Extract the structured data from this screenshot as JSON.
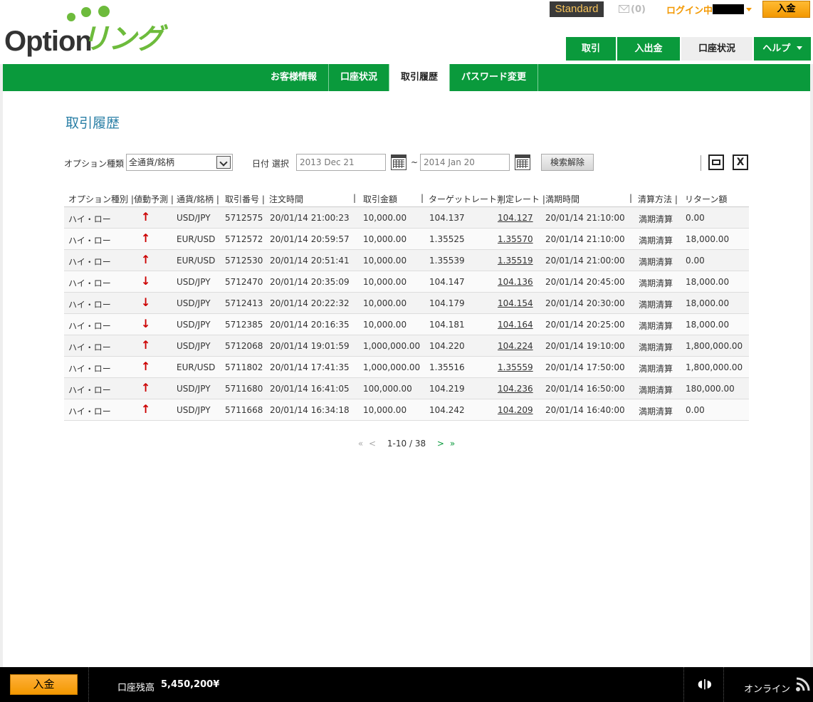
{
  "header": {
    "logo_text": "Option",
    "logo_kana": "リング",
    "account_type": "Standard",
    "mail_count": "(0)",
    "login_status": "ログイン中",
    "deposit_label": "入金",
    "main_tabs": [
      "取引",
      "入出金",
      "口座状況",
      "ヘルプ"
    ],
    "active_main_tab": "口座状況"
  },
  "subnav": {
    "items": [
      "お客様情報",
      "口座状況",
      "取引履歴",
      "パスワード変更"
    ],
    "active": "取引履歴"
  },
  "page": {
    "title": "取引履歴"
  },
  "filter": {
    "option_type_label": "オプション種類",
    "option_type_value": "全通貨/銘柄",
    "date_label": "日付 選択",
    "date_from": "2013 Dec 21",
    "tilde": "~",
    "date_to": "2014 Jan 20",
    "clear_label": "検索解除",
    "excel_label": "X"
  },
  "table": {
    "headers": [
      "オプション種別 |",
      "値動予測 |",
      "通貨/銘柄 |",
      "取引番号 |",
      "注文時間",
      "|",
      "取引金額",
      "|",
      "ターゲットレート |",
      "判定レート |",
      "満期時間",
      "|",
      "清算方法 |",
      "リターン額"
    ],
    "rows": [
      {
        "type": "ハイ・ロー",
        "dir": "↑",
        "pair": "USD/JPY",
        "id": "5712575",
        "order_time": "20/01/14 21:00:23",
        "amount": "10,000.00",
        "target": "104.137",
        "judge": "104.127",
        "expiry": "20/01/14 21:10:00",
        "settle": "満期清算",
        "return": "0.00"
      },
      {
        "type": "ハイ・ロー",
        "dir": "↑",
        "pair": "EUR/USD",
        "id": "5712572",
        "order_time": "20/01/14 20:59:57",
        "amount": "10,000.00",
        "target": "1.35525",
        "judge": "1.35570",
        "expiry": "20/01/14 21:10:00",
        "settle": "満期清算",
        "return": "18,000.00"
      },
      {
        "type": "ハイ・ロー",
        "dir": "↑",
        "pair": "EUR/USD",
        "id": "5712530",
        "order_time": "20/01/14 20:51:41",
        "amount": "10,000.00",
        "target": "1.35539",
        "judge": "1.35519",
        "expiry": "20/01/14 21:00:00",
        "settle": "満期清算",
        "return": "0.00"
      },
      {
        "type": "ハイ・ロー",
        "dir": "↓",
        "pair": "USD/JPY",
        "id": "5712470",
        "order_time": "20/01/14 20:35:09",
        "amount": "10,000.00",
        "target": "104.147",
        "judge": "104.136",
        "expiry": "20/01/14 20:45:00",
        "settle": "満期清算",
        "return": "18,000.00"
      },
      {
        "type": "ハイ・ロー",
        "dir": "↓",
        "pair": "USD/JPY",
        "id": "5712413",
        "order_time": "20/01/14 20:22:32",
        "amount": "10,000.00",
        "target": "104.179",
        "judge": "104.154",
        "expiry": "20/01/14 20:30:00",
        "settle": "満期清算",
        "return": "18,000.00"
      },
      {
        "type": "ハイ・ロー",
        "dir": "↓",
        "pair": "USD/JPY",
        "id": "5712385",
        "order_time": "20/01/14 20:16:35",
        "amount": "10,000.00",
        "target": "104.181",
        "judge": "104.164",
        "expiry": "20/01/14 20:25:00",
        "settle": "満期清算",
        "return": "18,000.00"
      },
      {
        "type": "ハイ・ロー",
        "dir": "↑",
        "pair": "USD/JPY",
        "id": "5712068",
        "order_time": "20/01/14 19:01:59",
        "amount": "1,000,000.00",
        "target": "104.220",
        "judge": "104.224",
        "expiry": "20/01/14 19:10:00",
        "settle": "満期清算",
        "return": "1,800,000.00"
      },
      {
        "type": "ハイ・ロー",
        "dir": "↑",
        "pair": "EUR/USD",
        "id": "5711802",
        "order_time": "20/01/14 17:41:35",
        "amount": "1,000,000.00",
        "target": "1.35516",
        "judge": "1.35559",
        "expiry": "20/01/14 17:50:00",
        "settle": "満期清算",
        "return": "1,800,000.00"
      },
      {
        "type": "ハイ・ロー",
        "dir": "↑",
        "pair": "USD/JPY",
        "id": "5711680",
        "order_time": "20/01/14 16:41:05",
        "amount": "100,000.00",
        "target": "104.219",
        "judge": "104.236",
        "expiry": "20/01/14 16:50:00",
        "settle": "満期清算",
        "return": "180,000.00"
      },
      {
        "type": "ハイ・ロー",
        "dir": "↑",
        "pair": "USD/JPY",
        "id": "5711668",
        "order_time": "20/01/14 16:34:18",
        "amount": "10,000.00",
        "target": "104.242",
        "judge": "104.209",
        "expiry": "20/01/14 16:40:00",
        "settle": "満期清算",
        "return": "0.00"
      }
    ]
  },
  "pager": {
    "first": "«",
    "prev": "<",
    "info": "1-10 / 38",
    "next": ">",
    "last": "»"
  },
  "footer": {
    "deposit_label": "入金",
    "balance_label": "口座残高",
    "balance_value": "5,450,200¥",
    "online_label": "オンライン"
  },
  "colors": {
    "brand_green": "#0a9a3c",
    "accent_orange": "#f39800",
    "title_blue": "#2a7fa6",
    "arrow_red": "#cc0000"
  }
}
